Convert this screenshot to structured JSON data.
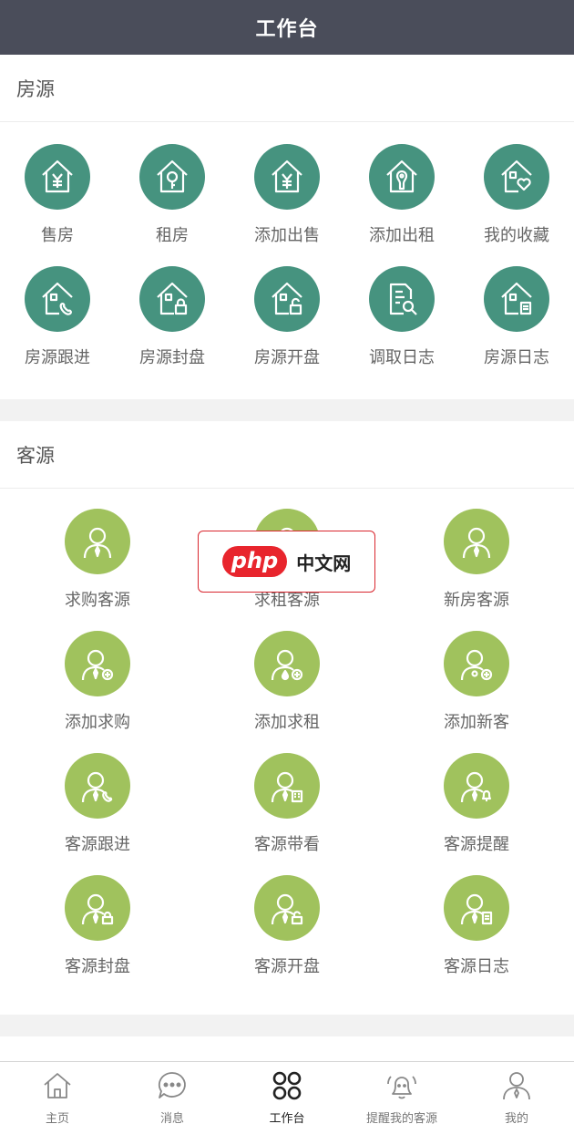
{
  "header": {
    "title": "工作台"
  },
  "house_section": {
    "title": "房源",
    "items": [
      {
        "label": "售房",
        "icon": "house-yen-icon"
      },
      {
        "label": "租房",
        "icon": "house-key-icon"
      },
      {
        "label": "添加出售",
        "icon": "house-yen-add-icon"
      },
      {
        "label": "添加出租",
        "icon": "house-key-add-icon"
      },
      {
        "label": "我的收藏",
        "icon": "house-heart-icon"
      },
      {
        "label": "房源跟进",
        "icon": "house-phone-icon"
      },
      {
        "label": "房源封盘",
        "icon": "house-lock-icon"
      },
      {
        "label": "房源开盘",
        "icon": "house-unlock-icon"
      },
      {
        "label": "调取日志",
        "icon": "document-search-icon"
      },
      {
        "label": "房源日志",
        "icon": "house-document-icon"
      }
    ]
  },
  "client_section": {
    "title": "客源",
    "items": [
      {
        "label": "求购客源",
        "icon": "person-tie-icon"
      },
      {
        "label": "求租客源",
        "icon": "person-drop-icon"
      },
      {
        "label": "新房客源",
        "icon": "person-tie-icon"
      },
      {
        "label": "添加求购",
        "icon": "person-add-icon"
      },
      {
        "label": "添加求租",
        "icon": "person-add-icon"
      },
      {
        "label": "添加新客",
        "icon": "person-add-icon"
      },
      {
        "label": "客源跟进",
        "icon": "person-phone-icon"
      },
      {
        "label": "客源带看",
        "icon": "person-building-icon"
      },
      {
        "label": "客源提醒",
        "icon": "person-bell-icon"
      },
      {
        "label": "客源封盘",
        "icon": "person-lock-icon"
      },
      {
        "label": "客源开盘",
        "icon": "person-unlock-icon"
      },
      {
        "label": "客源日志",
        "icon": "person-document-icon"
      }
    ]
  },
  "ad": {
    "brand": "php",
    "text": "中文网"
  },
  "tabbar": {
    "active_index": 2,
    "tabs": [
      {
        "label": "主页",
        "icon": "home-icon"
      },
      {
        "label": "消息",
        "icon": "chat-bubble-icon"
      },
      {
        "label": "工作台",
        "icon": "workbench-grid-icon"
      },
      {
        "label": "提醒我的客源",
        "icon": "bell-icon"
      },
      {
        "label": "我的",
        "icon": "person-icon"
      }
    ]
  },
  "colors": {
    "topbar": "#4a4d5a",
    "house_icon_bg": "#46937f",
    "client_icon_bg": "#a0c25d",
    "ad_red": "#e8252d"
  }
}
